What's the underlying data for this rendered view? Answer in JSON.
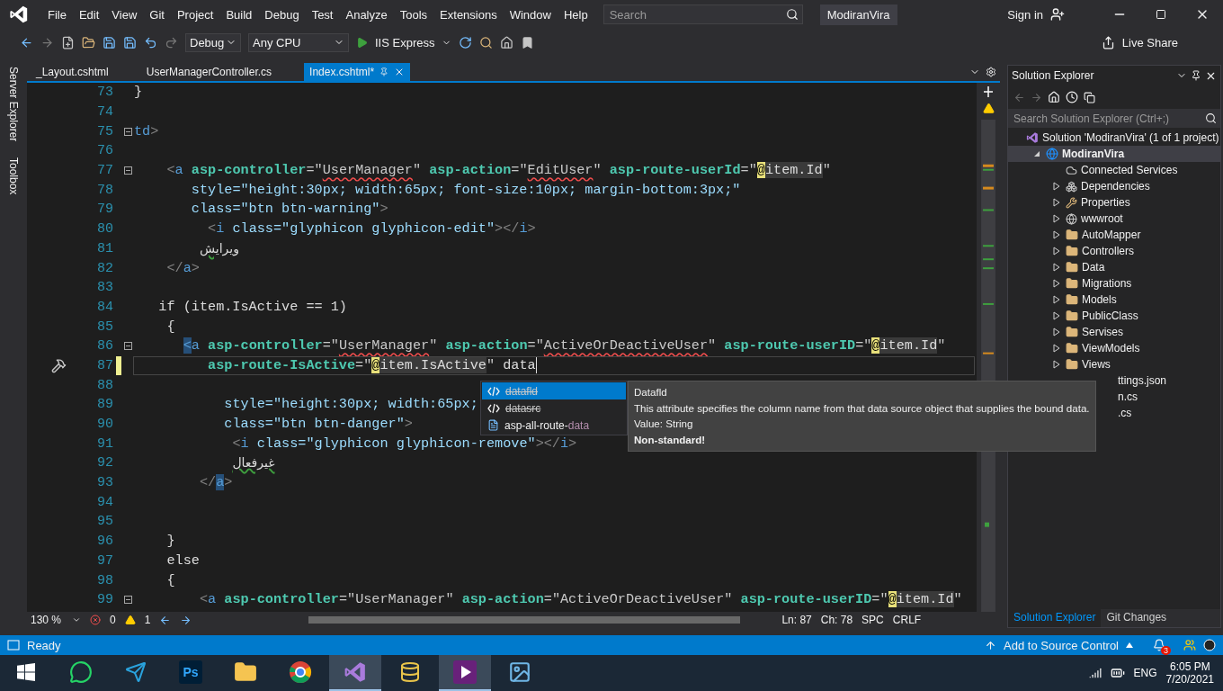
{
  "menu": {
    "items": [
      "File",
      "Edit",
      "View",
      "Git",
      "Project",
      "Build",
      "Debug",
      "Test",
      "Analyze",
      "Tools",
      "Extensions",
      "Window",
      "Help"
    ],
    "search": {
      "placeholder": "Search"
    },
    "solution_name": "ModiranVira",
    "sign_in": "Sign in"
  },
  "toolbar": {
    "configuration": "Debug",
    "platform": "Any CPU",
    "run_target": "IIS Express",
    "live_share": "Live Share"
  },
  "side_tabs": [
    "Server Explorer",
    "Toolbox"
  ],
  "tabs": [
    {
      "label": "_Layout.cshtml",
      "selected": false
    },
    {
      "label": "UserManagerController.cs",
      "selected": false
    },
    {
      "label": "Index.cshtml*",
      "selected": true
    }
  ],
  "editor": {
    "lines": [
      {
        "n": "73",
        "tokens": [
          {
            "kind": "plain",
            "t": "}"
          }
        ]
      },
      {
        "n": "74"
      },
      {
        "n": "75",
        "fold": true,
        "tokens": [
          {
            "kind": "tag",
            "t": "td"
          },
          {
            "kind": "punct",
            "t": ">"
          }
        ]
      },
      {
        "n": "76"
      },
      {
        "n": "77",
        "fold": true,
        "tokens": [
          {
            "kind": "punct",
            "t": "    <"
          },
          {
            "kind": "tag",
            "t": "a"
          },
          {
            "kind": "helper",
            "t": " asp-controller"
          },
          {
            "kind": "value",
            "t": "=\""
          },
          {
            "kind": "value",
            "t": "UserManager",
            "error": true
          },
          {
            "kind": "value",
            "t": "\" "
          },
          {
            "kind": "helper",
            "t": "asp-action"
          },
          {
            "kind": "value",
            "t": "=\""
          },
          {
            "kind": "value",
            "t": "EditUser",
            "error": true
          },
          {
            "kind": "value",
            "t": "\" "
          },
          {
            "kind": "helper",
            "t": "asp-route-userId"
          },
          {
            "kind": "value",
            "t": "=\""
          },
          {
            "kind": "razor",
            "t": "@"
          },
          {
            "kind": "expr",
            "t": "item.Id"
          },
          {
            "kind": "value",
            "t": "\""
          }
        ]
      },
      {
        "n": "78",
        "tokens": [
          {
            "kind": "attr",
            "t": "       style=\"height:30px; width:65px; font-size:10px; margin-bottom:3px;\""
          }
        ]
      },
      {
        "n": "79",
        "tokens": [
          {
            "kind": "attr",
            "t": "       class=\"btn btn-warning\""
          },
          {
            "kind": "punct",
            "t": ">"
          }
        ]
      },
      {
        "n": "80",
        "tokens": [
          {
            "kind": "punct",
            "t": "         <"
          },
          {
            "kind": "tag",
            "t": "i"
          },
          {
            "kind": "attr",
            "t": " class=\"glyphicon glyphicon-edit\""
          },
          {
            "kind": "punct",
            "t": "></"
          },
          {
            "kind": "tag",
            "t": "i"
          },
          {
            "kind": "punct",
            "t": ">"
          }
        ]
      },
      {
        "n": "81",
        "tokens": [
          {
            "kind": "rtl",
            "t": "        ویرایش",
            "warning": true
          }
        ]
      },
      {
        "n": "82",
        "tokens": [
          {
            "kind": "punct",
            "t": "    </"
          },
          {
            "kind": "tag",
            "t": "a"
          },
          {
            "kind": "punct",
            "t": ">"
          }
        ]
      },
      {
        "n": "83"
      },
      {
        "n": "84",
        "tokens": [
          {
            "kind": "plain",
            "t": "   if (item.IsActive == 1)"
          }
        ]
      },
      {
        "n": "85",
        "tokens": [
          {
            "kind": "plain",
            "t": "    {"
          }
        ]
      },
      {
        "n": "86",
        "fold": true,
        "tokens": [
          {
            "kind": "match",
            "t": "      <"
          },
          {
            "kind": "tag",
            "t": "a"
          },
          {
            "kind": "helper",
            "t": " asp-controller"
          },
          {
            "kind": "value",
            "t": "=\""
          },
          {
            "kind": "value",
            "t": "UserManager",
            "error": true
          },
          {
            "kind": "value",
            "t": "\" "
          },
          {
            "kind": "helper",
            "t": "asp-action"
          },
          {
            "kind": "value",
            "t": "=\""
          },
          {
            "kind": "value",
            "t": "ActiveOrDeactiveUser",
            "error": true
          },
          {
            "kind": "value",
            "t": "\" "
          },
          {
            "kind": "helper",
            "t": "asp-route-userID"
          },
          {
            "kind": "value",
            "t": "=\""
          },
          {
            "kind": "razor",
            "t": "@"
          },
          {
            "kind": "expr",
            "t": "item.Id"
          },
          {
            "kind": "value",
            "t": "\""
          }
        ]
      },
      {
        "n": "87",
        "modified": true,
        "current": true,
        "tokens": [
          {
            "kind": "helper",
            "t": "         asp-route-IsActive"
          },
          {
            "kind": "value",
            "t": "=\""
          },
          {
            "kind": "razor",
            "t": "@"
          },
          {
            "kind": "expr",
            "t": "item.IsActive"
          },
          {
            "kind": "value",
            "t": "\" "
          },
          {
            "kind": "plain",
            "t": "data"
          }
        ]
      },
      {
        "n": "88"
      },
      {
        "n": "89",
        "tokens": [
          {
            "kind": "attr",
            "t": "           style=\"height:30px; width:65px;"
          }
        ]
      },
      {
        "n": "90",
        "tokens": [
          {
            "kind": "attr",
            "t": "           class=\"btn btn-danger\""
          },
          {
            "kind": "punct",
            "t": ">"
          }
        ]
      },
      {
        "n": "91",
        "tokens": [
          {
            "kind": "punct",
            "t": "            <"
          },
          {
            "kind": "tag",
            "t": "i"
          },
          {
            "kind": "attr",
            "t": " class=\"glyphicon glyphicon-remove\""
          },
          {
            "kind": "punct",
            "t": "></"
          },
          {
            "kind": "tag",
            "t": "i"
          },
          {
            "kind": "punct",
            "t": ">"
          }
        ]
      },
      {
        "n": "92",
        "tokens": [
          {
            "kind": "rtl",
            "t": "            غیرفعال",
            "warning": true
          }
        ]
      },
      {
        "n": "93",
        "tokens": [
          {
            "kind": "punct",
            "t": "        </"
          },
          {
            "kind": "match",
            "t": "a"
          },
          {
            "kind": "punct",
            "t": ">"
          }
        ]
      },
      {
        "n": "94"
      },
      {
        "n": "95"
      },
      {
        "n": "96",
        "tokens": [
          {
            "kind": "plain",
            "t": "    }"
          }
        ]
      },
      {
        "n": "97",
        "tokens": [
          {
            "kind": "plain",
            "t": "    else"
          }
        ]
      },
      {
        "n": "98",
        "tokens": [
          {
            "kind": "plain",
            "t": "    {"
          }
        ]
      },
      {
        "n": "99",
        "fold": true,
        "tokens": [
          {
            "kind": "punct",
            "t": "        <"
          },
          {
            "kind": "tag",
            "t": "a"
          },
          {
            "kind": "helper",
            "t": " asp-controller"
          },
          {
            "kind": "value",
            "t": "=\"UserManager\" "
          },
          {
            "kind": "helper",
            "t": "asp-action"
          },
          {
            "kind": "value",
            "t": "=\"ActiveOrDeactiveUser\" "
          },
          {
            "kind": "helper",
            "t": "asp-route-userID"
          },
          {
            "kind": "value",
            "t": "=\""
          },
          {
            "kind": "razor",
            "t": "@"
          },
          {
            "kind": "expr",
            "t": "item.Id"
          },
          {
            "kind": "value",
            "t": "\""
          }
        ]
      }
    ],
    "completion": {
      "items": [
        {
          "kind": "attribute",
          "label": "datafld",
          "deprecated": true,
          "selected": true
        },
        {
          "kind": "attribute",
          "label": "datasrc",
          "deprecated": true,
          "selected": false
        },
        {
          "kind": "tag-helper",
          "label": "asp-all-route-",
          "match": "data",
          "deprecated": false,
          "selected": false
        }
      ],
      "tooltip": {
        "title": "Datafld",
        "description": "This attribute specifies the column name from that data source object that supplies the bound data.",
        "value_type": "Value: String",
        "note": "Non-standard!"
      }
    },
    "zoom": "130 %",
    "errors": "0",
    "warnings": "1",
    "line": "Ln: 87",
    "column": "Ch: 78",
    "whitespace": "SPC",
    "line_endings": "CRLF"
  },
  "solution_explorer": {
    "title": "Solution Explorer",
    "search": {
      "placeholder": "Search Solution Explorer (Ctrl+;)"
    },
    "tree": [
      {
        "label": "Solution 'ModiranVira' (1 of 1 project)",
        "kind": "solution",
        "selected": false,
        "children": [
          {
            "label": "ModiranVira",
            "kind": "project",
            "expanded": true,
            "selected": true,
            "children": [
              {
                "label": "Connected Services",
                "kind": "service",
                "selected": false
              },
              {
                "label": "Dependencies",
                "kind": "dependencies",
                "expanded": false,
                "selected": false
              },
              {
                "label": "Properties",
                "kind": "properties",
                "expanded": false,
                "selected": false
              },
              {
                "label": "wwwroot",
                "kind": "web",
                "expanded": false,
                "selected": false
              },
              {
                "label": "AutoMapper",
                "kind": "folder",
                "expanded": false,
                "selected": false
              },
              {
                "label": "Controllers",
                "kind": "folder",
                "expanded": false,
                "selected": false
              },
              {
                "label": "Data",
                "kind": "folder",
                "expanded": false,
                "selected": false
              },
              {
                "label": "Migrations",
                "kind": "folder",
                "expanded": false,
                "selected": false
              },
              {
                "label": "Models",
                "kind": "folder",
                "expanded": false,
                "selected": false
              },
              {
                "label": "PublicClass",
                "kind": "folder",
                "expanded": false,
                "selected": false
              },
              {
                "label": "Servises",
                "kind": "folder",
                "expanded": false,
                "selected": false
              },
              {
                "label": "ViewModels",
                "kind": "folder",
                "expanded": false,
                "selected": false
              },
              {
                "label": "Views",
                "kind": "folder",
                "expanded": false,
                "selected": false
              },
              {
                "label": "ttings.json",
                "kind": "file",
                "covered": true,
                "selected": false
              },
              {
                "label": "n.cs",
                "kind": "file",
                "covered": true,
                "selected": false
              },
              {
                "label": ".cs",
                "kind": "file",
                "covered": true,
                "selected": false
              }
            ]
          }
        ]
      }
    ],
    "bottom_tabs": [
      {
        "label": "Solution Explorer",
        "selected": true
      },
      {
        "label": "Git Changes",
        "selected": false
      }
    ]
  },
  "status_bar": {
    "state": "Ready",
    "source_control": "Add to Source Control",
    "notifications": "3"
  },
  "taskbar": {
    "apps": [
      {
        "kind": "whatsapp",
        "active": false
      },
      {
        "kind": "telegram",
        "active": false
      },
      {
        "kind": "photoshop",
        "label": "Ps",
        "active": false
      },
      {
        "kind": "explorer",
        "active": false
      },
      {
        "kind": "chrome",
        "active": false
      },
      {
        "kind": "vs",
        "active": true
      },
      {
        "kind": "database",
        "active": false
      },
      {
        "kind": "vs-preview",
        "active": true
      },
      {
        "kind": "photos",
        "active": false
      }
    ],
    "language": "ENG",
    "time": "6:05 PM",
    "date": "7/20/2021"
  }
}
